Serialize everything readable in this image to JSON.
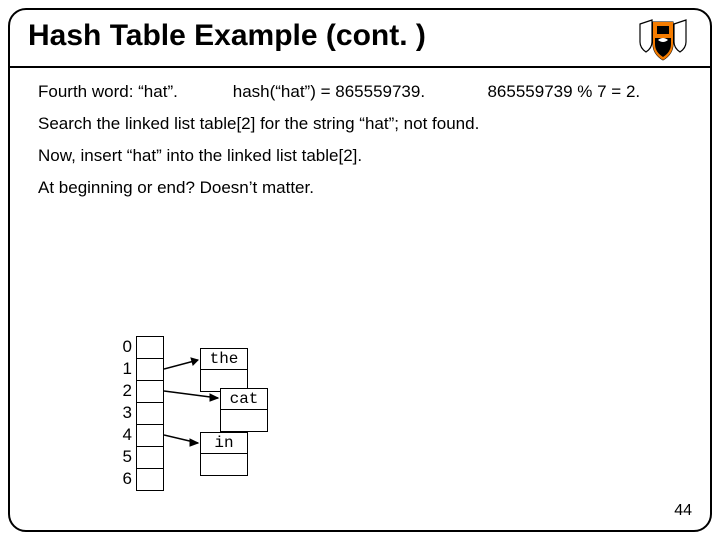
{
  "title": "Hash Table Example (cont. )",
  "lines": {
    "l1a": "Fourth word:  “hat”.",
    "l1b": "hash(“hat”) = 865559739.",
    "l1c": "865559739 % 7 = 2.",
    "l2": "Search the linked list   table[2]  for the string “hat”; not found.",
    "l3": "Now, insert “hat” into the linked list  table[2].",
    "l4": "At beginning or end?  Doesn’t matter."
  },
  "indices": [
    "0",
    "1",
    "2",
    "3",
    "4",
    "5",
    "6"
  ],
  "words": {
    "w0": "the",
    "w1": "cat",
    "w2": "in"
  },
  "pagenum": "44"
}
